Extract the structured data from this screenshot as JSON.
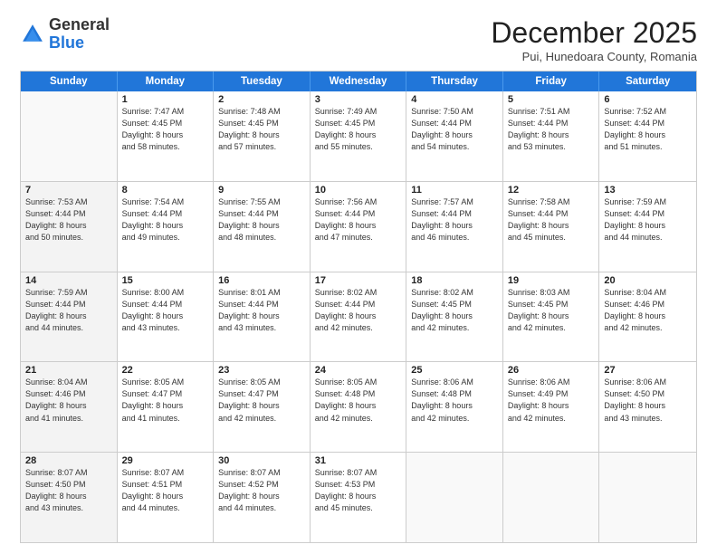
{
  "logo": {
    "general": "General",
    "blue": "Blue"
  },
  "title": "December 2025",
  "subtitle": "Pui, Hunedoara County, Romania",
  "header_days": [
    "Sunday",
    "Monday",
    "Tuesday",
    "Wednesday",
    "Thursday",
    "Friday",
    "Saturday"
  ],
  "weeks": [
    [
      {
        "day": "",
        "lines": [],
        "empty": true
      },
      {
        "day": "1",
        "lines": [
          "Sunrise: 7:47 AM",
          "Sunset: 4:45 PM",
          "Daylight: 8 hours",
          "and 58 minutes."
        ]
      },
      {
        "day": "2",
        "lines": [
          "Sunrise: 7:48 AM",
          "Sunset: 4:45 PM",
          "Daylight: 8 hours",
          "and 57 minutes."
        ]
      },
      {
        "day": "3",
        "lines": [
          "Sunrise: 7:49 AM",
          "Sunset: 4:45 PM",
          "Daylight: 8 hours",
          "and 55 minutes."
        ]
      },
      {
        "day": "4",
        "lines": [
          "Sunrise: 7:50 AM",
          "Sunset: 4:44 PM",
          "Daylight: 8 hours",
          "and 54 minutes."
        ]
      },
      {
        "day": "5",
        "lines": [
          "Sunrise: 7:51 AM",
          "Sunset: 4:44 PM",
          "Daylight: 8 hours",
          "and 53 minutes."
        ]
      },
      {
        "day": "6",
        "lines": [
          "Sunrise: 7:52 AM",
          "Sunset: 4:44 PM",
          "Daylight: 8 hours",
          "and 51 minutes."
        ]
      }
    ],
    [
      {
        "day": "7",
        "lines": [
          "Sunrise: 7:53 AM",
          "Sunset: 4:44 PM",
          "Daylight: 8 hours",
          "and 50 minutes."
        ],
        "shaded": true
      },
      {
        "day": "8",
        "lines": [
          "Sunrise: 7:54 AM",
          "Sunset: 4:44 PM",
          "Daylight: 8 hours",
          "and 49 minutes."
        ]
      },
      {
        "day": "9",
        "lines": [
          "Sunrise: 7:55 AM",
          "Sunset: 4:44 PM",
          "Daylight: 8 hours",
          "and 48 minutes."
        ]
      },
      {
        "day": "10",
        "lines": [
          "Sunrise: 7:56 AM",
          "Sunset: 4:44 PM",
          "Daylight: 8 hours",
          "and 47 minutes."
        ]
      },
      {
        "day": "11",
        "lines": [
          "Sunrise: 7:57 AM",
          "Sunset: 4:44 PM",
          "Daylight: 8 hours",
          "and 46 minutes."
        ]
      },
      {
        "day": "12",
        "lines": [
          "Sunrise: 7:58 AM",
          "Sunset: 4:44 PM",
          "Daylight: 8 hours",
          "and 45 minutes."
        ]
      },
      {
        "day": "13",
        "lines": [
          "Sunrise: 7:59 AM",
          "Sunset: 4:44 PM",
          "Daylight: 8 hours",
          "and 44 minutes."
        ]
      }
    ],
    [
      {
        "day": "14",
        "lines": [
          "Sunrise: 7:59 AM",
          "Sunset: 4:44 PM",
          "Daylight: 8 hours",
          "and 44 minutes."
        ],
        "shaded": true
      },
      {
        "day": "15",
        "lines": [
          "Sunrise: 8:00 AM",
          "Sunset: 4:44 PM",
          "Daylight: 8 hours",
          "and 43 minutes."
        ]
      },
      {
        "day": "16",
        "lines": [
          "Sunrise: 8:01 AM",
          "Sunset: 4:44 PM",
          "Daylight: 8 hours",
          "and 43 minutes."
        ]
      },
      {
        "day": "17",
        "lines": [
          "Sunrise: 8:02 AM",
          "Sunset: 4:44 PM",
          "Daylight: 8 hours",
          "and 42 minutes."
        ]
      },
      {
        "day": "18",
        "lines": [
          "Sunrise: 8:02 AM",
          "Sunset: 4:45 PM",
          "Daylight: 8 hours",
          "and 42 minutes."
        ]
      },
      {
        "day": "19",
        "lines": [
          "Sunrise: 8:03 AM",
          "Sunset: 4:45 PM",
          "Daylight: 8 hours",
          "and 42 minutes."
        ]
      },
      {
        "day": "20",
        "lines": [
          "Sunrise: 8:04 AM",
          "Sunset: 4:46 PM",
          "Daylight: 8 hours",
          "and 42 minutes."
        ]
      }
    ],
    [
      {
        "day": "21",
        "lines": [
          "Sunrise: 8:04 AM",
          "Sunset: 4:46 PM",
          "Daylight: 8 hours",
          "and 41 minutes."
        ],
        "shaded": true
      },
      {
        "day": "22",
        "lines": [
          "Sunrise: 8:05 AM",
          "Sunset: 4:47 PM",
          "Daylight: 8 hours",
          "and 41 minutes."
        ]
      },
      {
        "day": "23",
        "lines": [
          "Sunrise: 8:05 AM",
          "Sunset: 4:47 PM",
          "Daylight: 8 hours",
          "and 42 minutes."
        ]
      },
      {
        "day": "24",
        "lines": [
          "Sunrise: 8:05 AM",
          "Sunset: 4:48 PM",
          "Daylight: 8 hours",
          "and 42 minutes."
        ]
      },
      {
        "day": "25",
        "lines": [
          "Sunrise: 8:06 AM",
          "Sunset: 4:48 PM",
          "Daylight: 8 hours",
          "and 42 minutes."
        ]
      },
      {
        "day": "26",
        "lines": [
          "Sunrise: 8:06 AM",
          "Sunset: 4:49 PM",
          "Daylight: 8 hours",
          "and 42 minutes."
        ]
      },
      {
        "day": "27",
        "lines": [
          "Sunrise: 8:06 AM",
          "Sunset: 4:50 PM",
          "Daylight: 8 hours",
          "and 43 minutes."
        ]
      }
    ],
    [
      {
        "day": "28",
        "lines": [
          "Sunrise: 8:07 AM",
          "Sunset: 4:50 PM",
          "Daylight: 8 hours",
          "and 43 minutes."
        ],
        "shaded": true
      },
      {
        "day": "29",
        "lines": [
          "Sunrise: 8:07 AM",
          "Sunset: 4:51 PM",
          "Daylight: 8 hours",
          "and 44 minutes."
        ]
      },
      {
        "day": "30",
        "lines": [
          "Sunrise: 8:07 AM",
          "Sunset: 4:52 PM",
          "Daylight: 8 hours",
          "and 44 minutes."
        ]
      },
      {
        "day": "31",
        "lines": [
          "Sunrise: 8:07 AM",
          "Sunset: 4:53 PM",
          "Daylight: 8 hours",
          "and 45 minutes."
        ]
      },
      {
        "day": "",
        "lines": [],
        "empty": true
      },
      {
        "day": "",
        "lines": [],
        "empty": true
      },
      {
        "day": "",
        "lines": [],
        "empty": true
      }
    ]
  ]
}
